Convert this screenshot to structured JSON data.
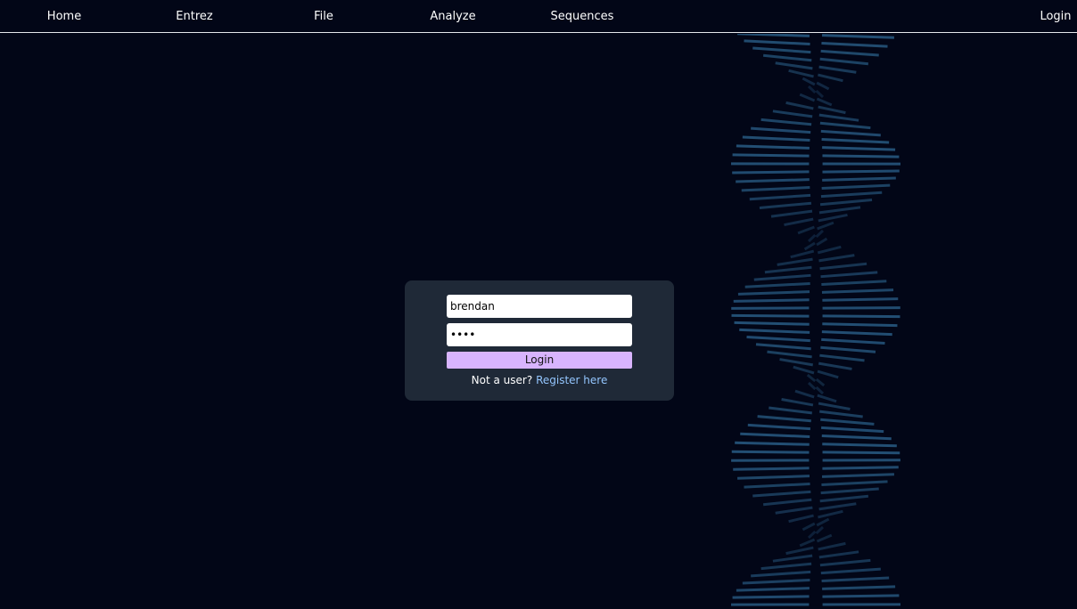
{
  "nav": {
    "home": "Home",
    "entrez": "Entrez",
    "file": "File",
    "analyze": "Analyze",
    "sequences": "Sequences",
    "login": "Login"
  },
  "login_form": {
    "username_value": "brendan",
    "password_value": "••••",
    "button_label": "Login",
    "register_prompt": "Not a user?",
    "register_link": "Register here"
  },
  "decoration": {
    "background_icon": "dna-helix-icon"
  },
  "colors": {
    "background": "#020617",
    "panel": "#1f2937",
    "button": "#d8b4fe",
    "link": "#93c5fd",
    "helix": "#2f6a96"
  }
}
